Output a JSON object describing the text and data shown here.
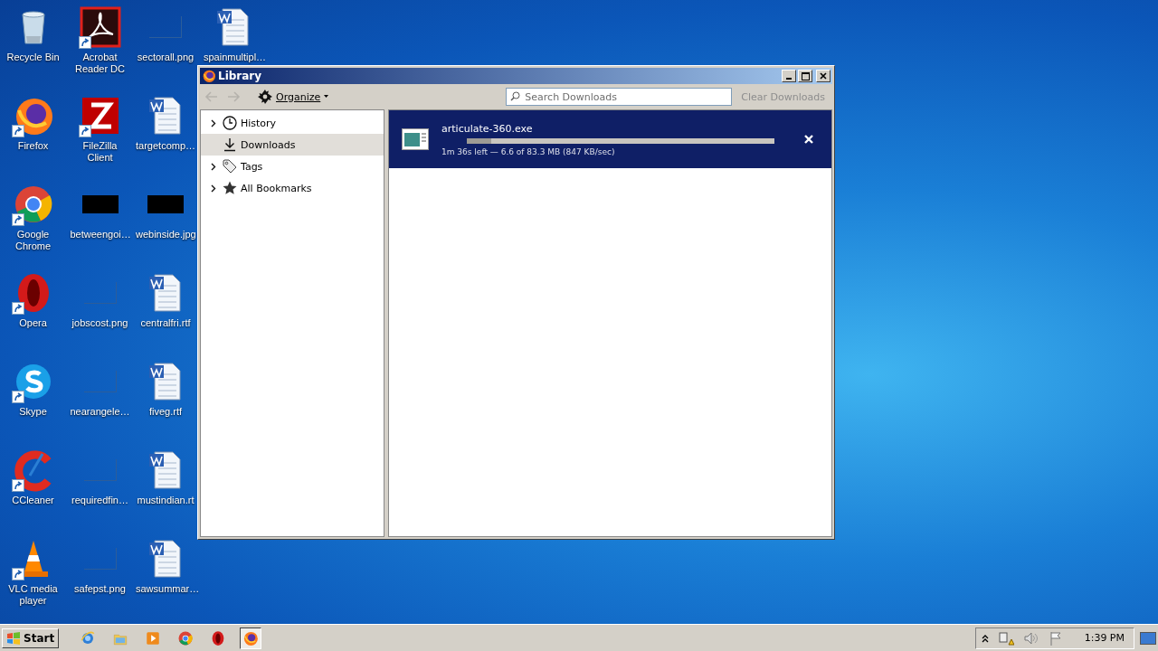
{
  "desktop_icons": [
    {
      "label": "Recycle Bin",
      "kind": "recycle",
      "shortcut": false
    },
    {
      "label": "Firefox",
      "kind": "firefox",
      "shortcut": true
    },
    {
      "label": "Google Chrome",
      "kind": "chrome",
      "shortcut": true
    },
    {
      "label": "Opera",
      "kind": "opera",
      "shortcut": true
    },
    {
      "label": "Skype",
      "kind": "skype",
      "shortcut": true
    },
    {
      "label": "CCleaner",
      "kind": "ccleaner",
      "shortcut": true
    },
    {
      "label": "VLC media player",
      "kind": "vlc",
      "shortcut": true
    },
    {
      "label": "Acrobat Reader DC",
      "kind": "acrobat",
      "shortcut": true
    },
    {
      "label": "FileZilla Client",
      "kind": "filezilla",
      "shortcut": true
    },
    {
      "label": "betweengoi…",
      "kind": "black",
      "shortcut": false
    },
    {
      "label": "jobscost.png",
      "kind": "blank",
      "shortcut": false
    },
    {
      "label": "nearangele…",
      "kind": "blank",
      "shortcut": false
    },
    {
      "label": "requiredfin…",
      "kind": "blank",
      "shortcut": false
    },
    {
      "label": "safepst.png",
      "kind": "blank",
      "shortcut": false
    },
    {
      "label": "sectorall.png",
      "kind": "blank",
      "shortcut": false
    },
    {
      "label": "targetcomp…",
      "kind": "word",
      "shortcut": false
    },
    {
      "label": "webinside.jpg",
      "kind": "black",
      "shortcut": false
    },
    {
      "label": "centralfri.rtf",
      "kind": "word",
      "shortcut": false
    },
    {
      "label": "fiveg.rtf",
      "kind": "word",
      "shortcut": false
    },
    {
      "label": "mustindian.rt",
      "kind": "word",
      "shortcut": false
    },
    {
      "label": "sawsummar…",
      "kind": "word",
      "shortcut": false
    },
    {
      "label": "spainmultipl…",
      "kind": "word",
      "shortcut": false
    }
  ],
  "window": {
    "title": "Library",
    "toolbar": {
      "nav": [
        {
          "kind": "back",
          "disabled": true
        },
        {
          "kind": "forward",
          "disabled": true
        }
      ],
      "organize": "Organize",
      "search": {
        "placeholder": "Search Downloads"
      },
      "clear_button": {
        "label": "Clear Downloads",
        "disabled": true
      }
    },
    "sidebar": {
      "items": [
        {
          "label": "History",
          "kind": "history",
          "expandable": true,
          "selected": false
        },
        {
          "label": "Downloads",
          "kind": "downloads",
          "expandable": false,
          "selected": true
        },
        {
          "label": "Tags",
          "kind": "tags",
          "expandable": true,
          "selected": false
        },
        {
          "label": "All Bookmarks",
          "kind": "bookmarks",
          "expandable": true,
          "selected": false
        }
      ]
    },
    "downloads": [
      {
        "name": "articulate-360.exe",
        "status": "1m 36s left — 6.6 of 83.3 MB (847 KB/sec)",
        "level": 0.08,
        "selected": true
      }
    ]
  },
  "taskbar": {
    "start": "Start",
    "apps": [
      {
        "kind": "ie",
        "active": false
      },
      {
        "kind": "folder",
        "active": false
      },
      {
        "kind": "media",
        "active": false
      },
      {
        "kind": "chrome",
        "active": false
      },
      {
        "kind": "opera",
        "active": false
      },
      {
        "kind": "firefox",
        "active": true
      }
    ],
    "clock": "1:39 PM"
  }
}
